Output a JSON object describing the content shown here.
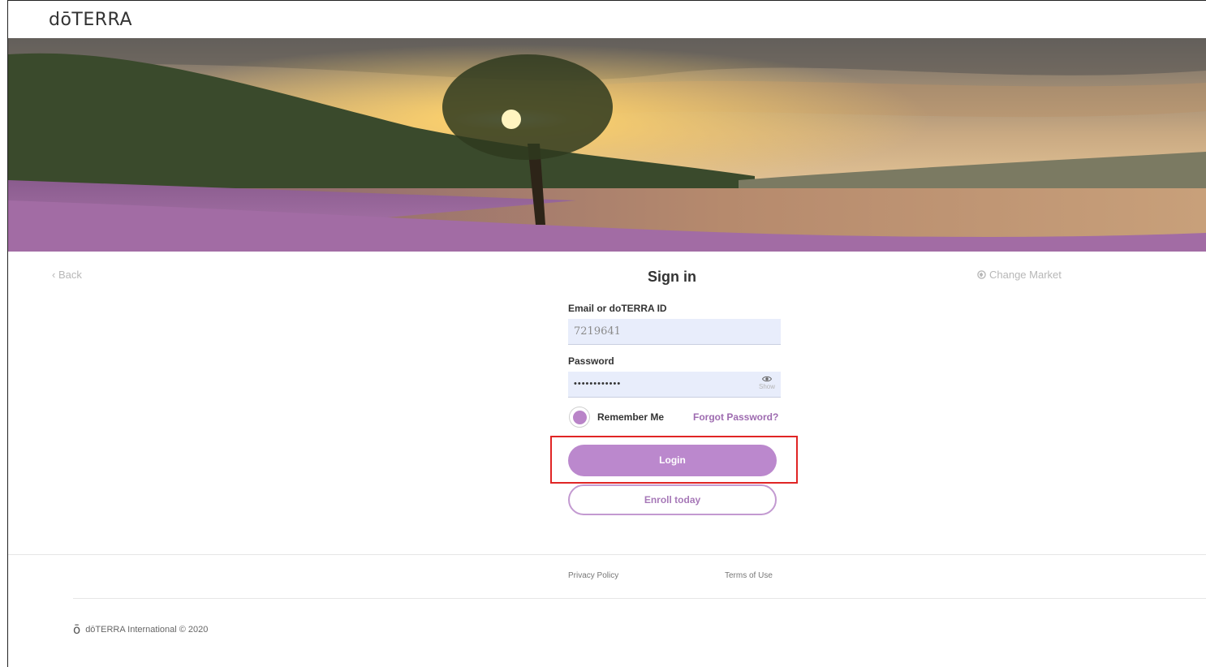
{
  "brand": {
    "logo_text": "dōTERRA"
  },
  "nav": {
    "back_label": "‹ Back",
    "change_market_label": "Change Market"
  },
  "form": {
    "title": "Sign in",
    "email_label": "Email or doTERRA ID",
    "email_value": "7219641",
    "password_label": "Password",
    "password_value": "••••••••••••",
    "show_label": "Show",
    "remember_label": "Remember Me",
    "remember_checked": true,
    "forgot_label": "Forgot Password?",
    "login_label": "Login",
    "enroll_label": "Enroll today"
  },
  "footer": {
    "privacy_label": "Privacy Policy",
    "terms_label": "Terms of Use",
    "copyright_mark": "ō",
    "copyright_text": "dōTERRA International © 2020"
  },
  "colors": {
    "accent": "#bb88cd",
    "accent_dark": "#9e6bb0",
    "input_bg": "#e8edfb",
    "highlight_box": "#e02525"
  },
  "icons": {
    "globe": "globe-icon",
    "eye": "eye-icon",
    "back_chevron": "chevron-left-icon"
  }
}
